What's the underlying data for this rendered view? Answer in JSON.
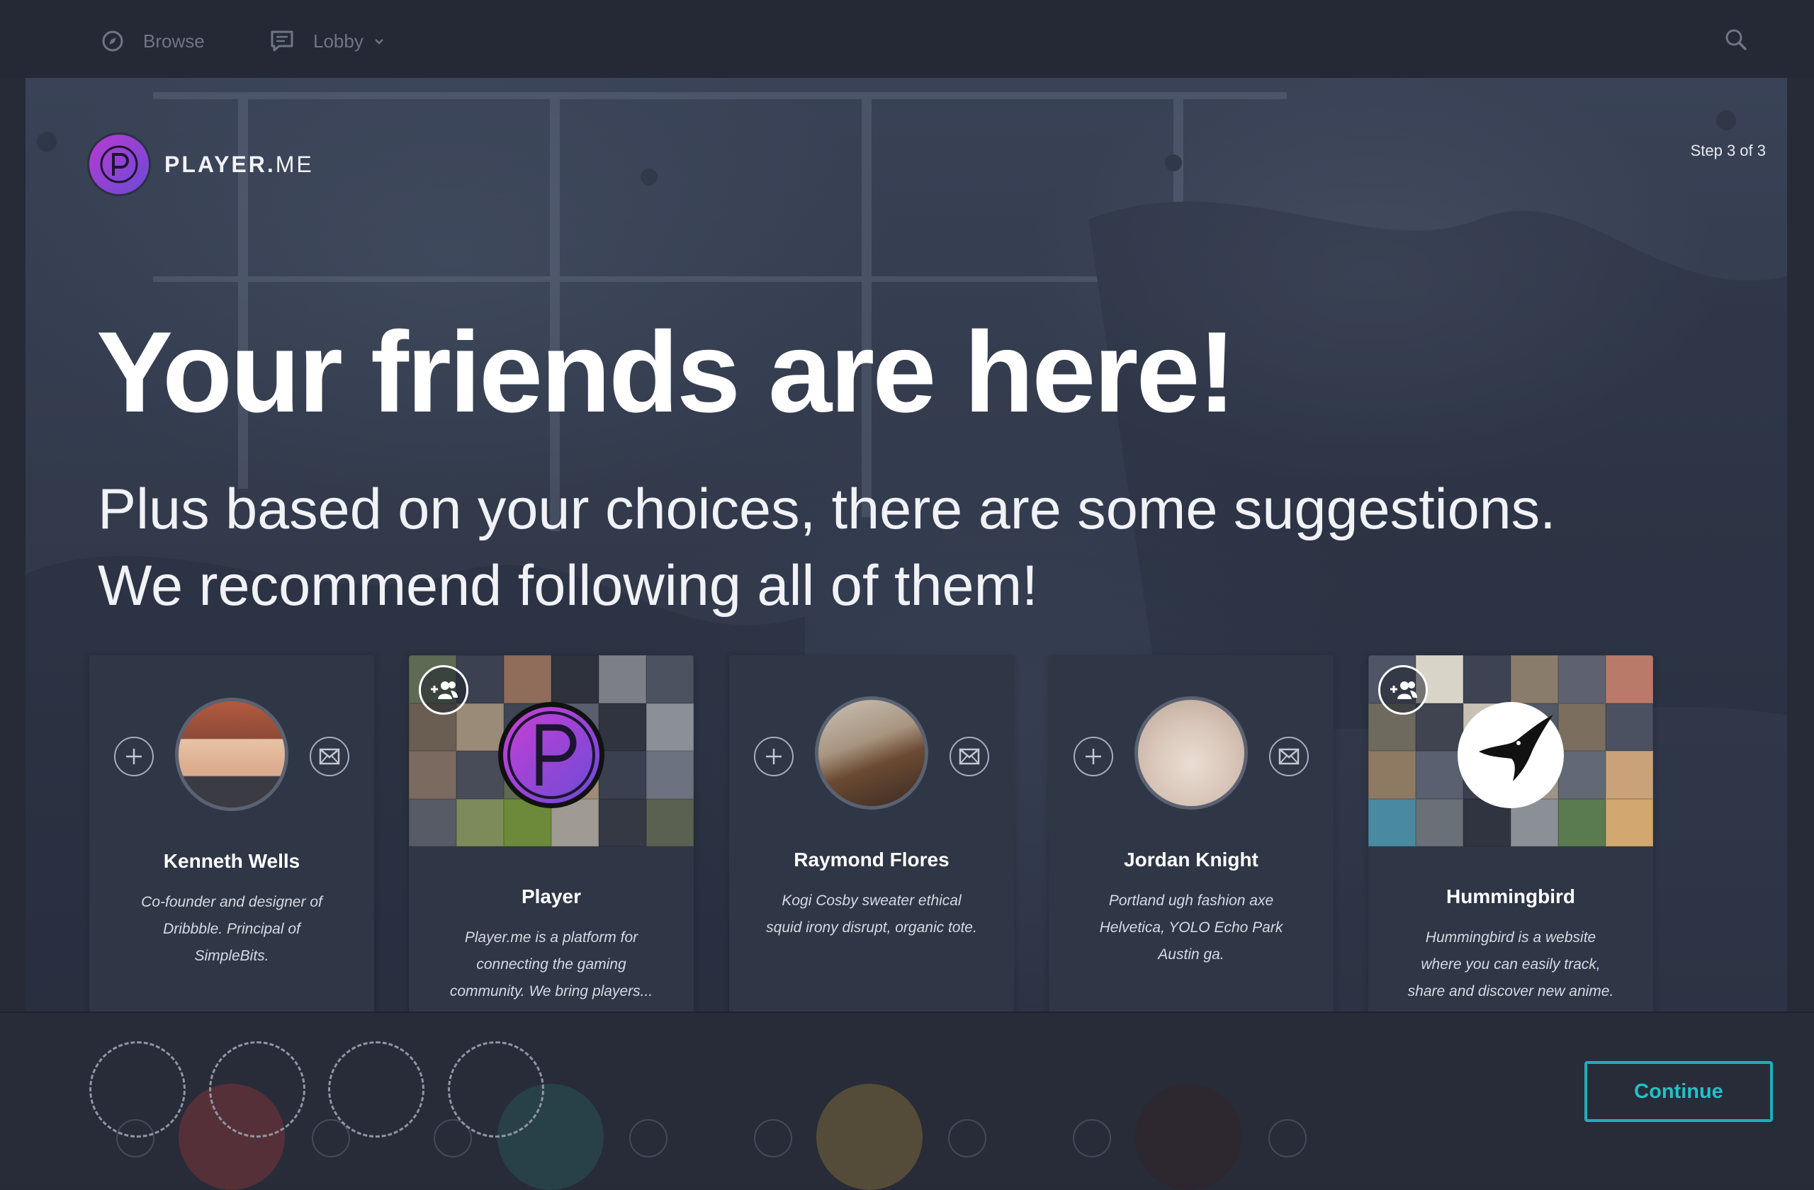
{
  "nav": {
    "browse_label": "Browse",
    "lobby_label": "Lobby",
    "icons": [
      "compass-icon",
      "chat-icon",
      "chevron-down-icon",
      "search-icon"
    ]
  },
  "brand": {
    "logo_text_bold": "PLAYER.",
    "logo_text_light": "ME",
    "accent_gradient": [
      "#b93ad0",
      "#6a4bd6"
    ]
  },
  "step_label": "Step 3 of 3",
  "headline": "Your friends are here!",
  "subtitle_line1": "Plus based on your choices, there are some suggestions.",
  "subtitle_line2": "We recommend following all of them!",
  "suggestions": [
    {
      "name": "Kenneth Wells",
      "description": "Co-founder and designer of Dribbble. Principal of SimpleBits.",
      "type": "user"
    },
    {
      "name": "Player",
      "description": "Player.me is a platform for connecting the gaming community. We bring players...",
      "type": "group"
    },
    {
      "name": "Raymond Flores",
      "description": "Kogi Cosby sweater ethical squid irony disrupt, organic tote.",
      "type": "user"
    },
    {
      "name": "Jordan Knight",
      "description": "Portland ugh fashion axe Helvetica, YOLO Echo Park Austin ga.",
      "type": "user"
    },
    {
      "name": "Hummingbird",
      "description": "Hummingbird is a website where you can easily track, share and discover new anime.",
      "type": "group"
    }
  ],
  "continue_label": "Continue",
  "colors": {
    "background": "#262b37",
    "card": "#2f3646",
    "continue_accent": "#1bb0b8"
  }
}
